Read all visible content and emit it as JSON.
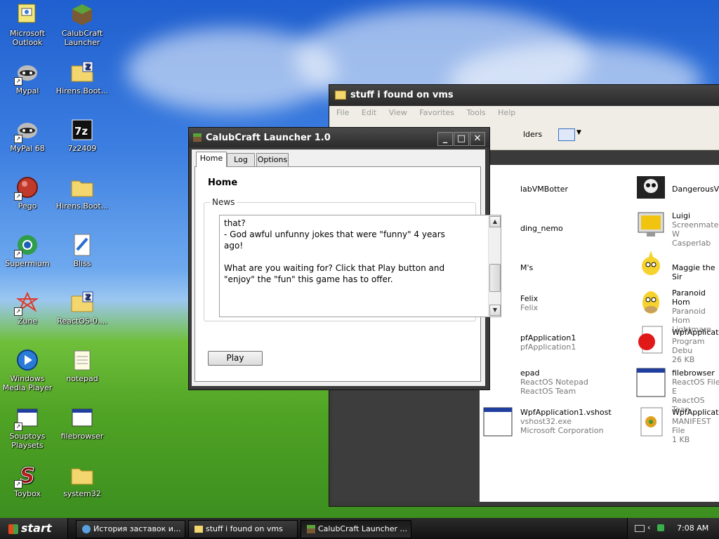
{
  "desktop": {
    "icons": [
      {
        "label": "Microsoft Outlook"
      },
      {
        "label": "CalubCraft Launcher"
      },
      {
        "label": "Mypal"
      },
      {
        "label": "Hirens.Boot..."
      },
      {
        "label": "MyPal 68"
      },
      {
        "label": "7z2409"
      },
      {
        "label": "Pego"
      },
      {
        "label": "Hirens.Boot..."
      },
      {
        "label": "Supermium"
      },
      {
        "label": "Bliss"
      },
      {
        "label": "Zune"
      },
      {
        "label": "ReactOS-0...."
      },
      {
        "label": "Windows Media Player"
      },
      {
        "label": "notepad"
      },
      {
        "label": "Souptoys Playsets"
      },
      {
        "label": "filebrowser"
      },
      {
        "label": "Toybox"
      },
      {
        "label": "system32"
      }
    ]
  },
  "explorer": {
    "title": "stuff i found on vms",
    "menu": [
      "File",
      "Edit",
      "View",
      "Favorites",
      "Tools",
      "Help"
    ],
    "toolbar_folders": "lders",
    "items": [
      {
        "name": "labVMBotter",
        "sub1": "",
        "sub2": ""
      },
      {
        "name": "DangerousViru",
        "sub1": "",
        "sub2": ""
      },
      {
        "name": "ding_nemo",
        "sub1": "",
        "sub2": ""
      },
      {
        "name": "Luigi",
        "sub1": "Screenmate W",
        "sub2": "Casperlab"
      },
      {
        "name": "M's",
        "sub1": "",
        "sub2": ""
      },
      {
        "name": "Maggie the Sir",
        "sub1": "",
        "sub2": ""
      },
      {
        "name": "Felix",
        "sub1": "Felix",
        "sub2": ""
      },
      {
        "name": "Paranoid Hom",
        "sub1": "Paranoid Hom",
        "sub2": "Lightmare"
      },
      {
        "name": "pfApplication1",
        "sub1": "pfApplication1",
        "sub2": ""
      },
      {
        "name": "WpfApplicatio",
        "sub1": "Program Debu",
        "sub2": "26 KB"
      },
      {
        "name": "epad",
        "sub1": "ReactOS Notepad",
        "sub2": "ReactOS Team"
      },
      {
        "name": "filebrowser",
        "sub1": "ReactOS File E",
        "sub2": "ReactOS Tean"
      },
      {
        "name": "WpfApplication1.vshost",
        "sub1": "vshost32.exe",
        "sub2": "Microsoft Corporation"
      },
      {
        "name": "WpfApplicatio",
        "sub1": "MANIFEST File",
        "sub2": "1 KB"
      }
    ]
  },
  "launcher": {
    "title": "CalubCraft Launcher 1.0",
    "tabs": {
      "home": "Home",
      "log": "Log",
      "options": "Options"
    },
    "heading": "Home",
    "news_label": "News",
    "news_text": "that?\n- God awful unfunny jokes that were \"funny\" 4 years\nago!\n\nWhat are you waiting for? Click that Play button and\n\"enjoy\" the \"fun\" this game has to offer.",
    "play_label": "Play",
    "scroll_position": 0.72
  },
  "taskbar": {
    "start_label": "start",
    "buttons": [
      {
        "label": "История заставок и..."
      },
      {
        "label": "stuff i found on vms"
      },
      {
        "label": "CalubCraft Launcher ..."
      }
    ],
    "clock": "7:08 AM"
  },
  "colors": {
    "sky": "#3b7de0",
    "grass": "#4fa324",
    "window_frame": "#3b3b3b"
  }
}
